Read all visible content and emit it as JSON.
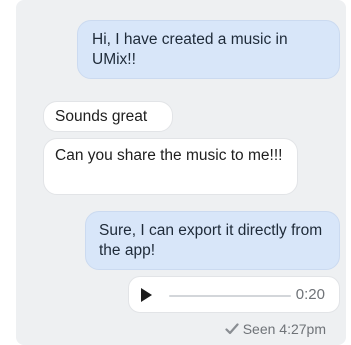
{
  "conversation": {
    "messages": [
      {
        "direction": "outgoing",
        "text": "Hi, I have created a music in UMix!!"
      },
      {
        "direction": "incoming",
        "text": "Sounds great"
      },
      {
        "direction": "incoming",
        "text": "Can you share the music to me!!!"
      },
      {
        "direction": "outgoing",
        "text": "Sure, I can export it directly from the app!"
      }
    ],
    "audio": {
      "icon": "play-icon",
      "duration": "0:20",
      "progress": 0
    },
    "status": {
      "icon": "check-icon",
      "text": "Seen 4:27pm"
    }
  }
}
